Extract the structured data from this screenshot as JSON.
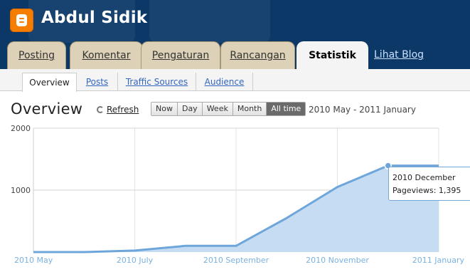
{
  "header": {
    "blog_title": "Abdul Sidik",
    "logo_icon": "blogger-logo-icon",
    "tabs": [
      {
        "label": "Posting",
        "active": false
      },
      {
        "label": "Komentar",
        "active": false
      },
      {
        "label": "Pengaturan",
        "active": false
      },
      {
        "label": "Rancangan",
        "active": false
      },
      {
        "label": "Statistik",
        "active": true
      }
    ],
    "view_blog_label": "Lihat Blog"
  },
  "subnav": {
    "items": [
      {
        "label": "Overview",
        "active": true
      },
      {
        "label": "Posts",
        "active": false
      },
      {
        "label": "Traffic Sources",
        "active": false
      },
      {
        "label": "Audience",
        "active": false
      }
    ]
  },
  "overview": {
    "title": "Overview",
    "refresh_label": "Refresh",
    "ranges": [
      {
        "label": "Now",
        "selected": false
      },
      {
        "label": "Day",
        "selected": false
      },
      {
        "label": "Week",
        "selected": false
      },
      {
        "label": "Month",
        "selected": false
      },
      {
        "label": "All time",
        "selected": true
      }
    ],
    "date_range": "2010 May - 2011 January"
  },
  "tooltip": {
    "title": "2010 December",
    "line": "Pageviews: 1,395"
  },
  "colors": {
    "header_bg": "#0c3868",
    "line": "#6ea6dc",
    "area": "#c6dcf3",
    "axis_label": "#7ab1e0"
  },
  "chart_data": {
    "type": "area",
    "series": [
      {
        "name": "Pageviews",
        "x": [
          "2010 May",
          "2010 June",
          "2010 July",
          "2010 August",
          "2010 September",
          "2010 October",
          "2010 November",
          "2010 December",
          "2011 January"
        ],
        "values": [
          0,
          0,
          25,
          100,
          100,
          550,
          1050,
          1395,
          1395
        ]
      }
    ],
    "ylim": [
      0,
      2000
    ],
    "y_ticks": [
      "2000",
      "1000"
    ],
    "x_tick_labels": [
      "2010 May",
      "2010 July",
      "2010 September",
      "2010 November",
      "2011 January"
    ],
    "x_tick_index": [
      0,
      2,
      4,
      6,
      8
    ],
    "highlighted_index": 7,
    "grid": true
  }
}
